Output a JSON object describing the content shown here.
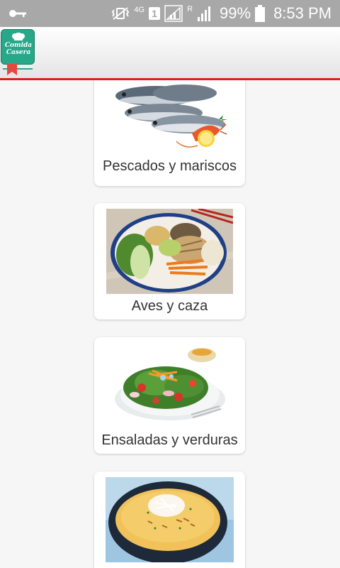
{
  "status_bar": {
    "battery": "99%",
    "time": "8:53 PM",
    "network_label": "4G",
    "sim_label": "1",
    "roaming_label": "R",
    "icons": [
      "key-icon",
      "vibrate-icon",
      "signal-icon",
      "battery-icon"
    ]
  },
  "app": {
    "logo_text_line1": "Comida",
    "logo_text_line2": "Casera",
    "accent_color": "#e21c1c",
    "brand_color": "#26a889"
  },
  "categories": [
    {
      "label": "Pescados y mariscos",
      "image": "fish-seafood-photo"
    },
    {
      "label": "Aves y caza",
      "image": "poultry-bowl-photo"
    },
    {
      "label": "Ensaladas y verduras",
      "image": "salad-photo"
    },
    {
      "label": "",
      "image": "soup-bowl-photo"
    }
  ]
}
